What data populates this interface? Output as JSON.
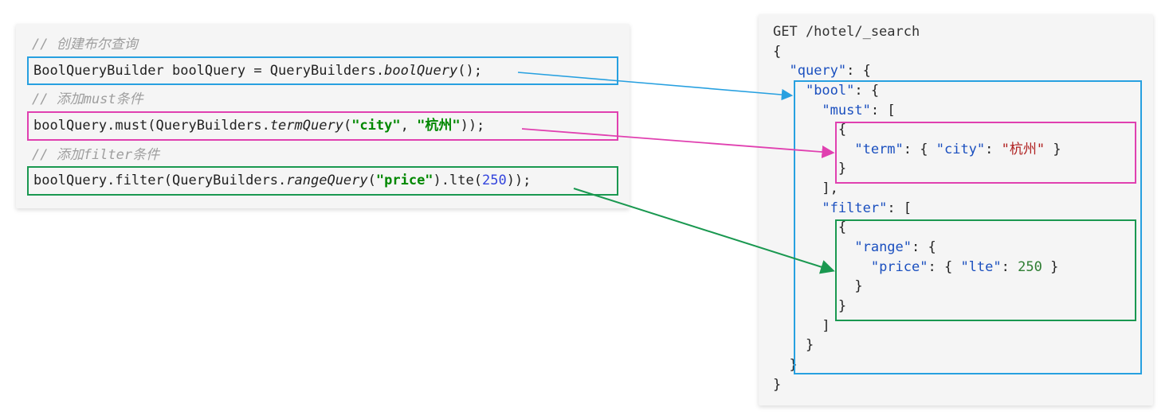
{
  "left": {
    "comment1": "// 创建布尔查询",
    "line1_a": "BoolQueryBuilder boolQuery = QueryBuilders.",
    "line1_b": "boolQuery",
    "line1_c": "();",
    "comment2": "// 添加must条件",
    "line2_a": "boolQuery.must(QueryBuilders.",
    "line2_b": "termQuery",
    "line2_c": "(",
    "line2_str1": "\"city\"",
    "line2_comma": ", ",
    "line2_str2": "\"杭州\"",
    "line2_d": "));",
    "comment3": "// 添加filter条件",
    "line3_a": "boolQuery.filter(QueryBuilders.",
    "line3_b": "rangeQuery",
    "line3_c": "(",
    "line3_str": "\"price\"",
    "line3_d": ").lte(",
    "line3_num": "250",
    "line3_e": "));"
  },
  "right": {
    "l0": "GET /hotel/_search",
    "l1": "{",
    "l2a": "  ",
    "l2k": "\"query\"",
    "l2b": ": {",
    "l3a": "    ",
    "l3k": "\"bool\"",
    "l3b": ": {",
    "l4a": "      ",
    "l4k": "\"must\"",
    "l4b": ": [",
    "l5": "        {",
    "l6a": "          ",
    "l6k": "\"term\"",
    "l6b": ": { ",
    "l6k2": "\"city\"",
    "l6c": ": ",
    "l6v": "\"杭州\"",
    "l6d": " }",
    "l7": "        }",
    "l8": "      ],",
    "l9a": "      ",
    "l9k": "\"filter\"",
    "l9b": ": [",
    "l10": "        {",
    "l11a": "          ",
    "l11k": "\"range\"",
    "l11b": ": {",
    "l12a": "            ",
    "l12k": "\"price\"",
    "l12b": ": { ",
    "l12k2": "\"lte\"",
    "l12c": ": ",
    "l12v": "250",
    "l12d": " }",
    "l13": "          }",
    "l14": "        }",
    "l15": "      ]",
    "l16": "    }",
    "l17": "  }",
    "l18": "}"
  },
  "chart_data": {
    "type": "diagram",
    "title": "Java BoolQueryBuilder ↔ Elasticsearch DSL mapping",
    "mappings": [
      {
        "java": "BoolQueryBuilder boolQuery = QueryBuilders.boolQuery();",
        "dsl_path": "query.bool",
        "color": "blue"
      },
      {
        "java": "boolQuery.must(QueryBuilders.termQuery(\"city\", \"杭州\"));",
        "dsl_path": "query.bool.must[0].term",
        "dsl_value": {
          "city": "杭州"
        },
        "color": "pink"
      },
      {
        "java": "boolQuery.filter(QueryBuilders.rangeQuery(\"price\").lte(250));",
        "dsl_path": "query.bool.filter[0].range",
        "dsl_value": {
          "price": {
            "lte": 250
          }
        },
        "color": "green"
      }
    ],
    "elasticsearch_request": {
      "method": "GET",
      "path": "/hotel/_search",
      "body": {
        "query": {
          "bool": {
            "must": [
              {
                "term": {
                  "city": "杭州"
                }
              }
            ],
            "filter": [
              {
                "range": {
                  "price": {
                    "lte": 250
                  }
                }
              }
            ]
          }
        }
      }
    }
  }
}
